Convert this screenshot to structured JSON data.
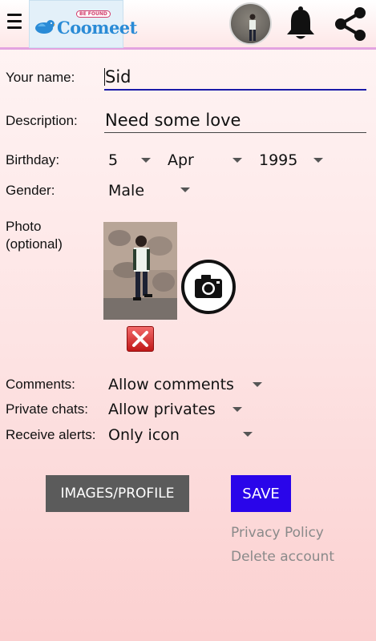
{
  "header": {
    "logo_tag": "BE FOUND",
    "logo_text": "Coomeet",
    "icons": [
      "menu-icon",
      "avatar",
      "bell-icon",
      "share-icon"
    ]
  },
  "form": {
    "name_label": "Your name:",
    "name_value": "Sid",
    "description_label": "Description:",
    "description_value": "Need some love",
    "birthday_label": "Birthday:",
    "birthday_day": "5",
    "birthday_month": "Apr",
    "birthday_year": "1995",
    "gender_label": "Gender:",
    "gender_value": "Male",
    "photo_label": "Photo",
    "photo_optional": "(optional)",
    "comments_label": "Comments:",
    "comments_value": "Allow comments",
    "private_label": "Private chats:",
    "private_value": "Allow privates",
    "alerts_label": "Receive alerts:",
    "alerts_value": "Only icon"
  },
  "actions": {
    "images_button": "IMAGES/PROFILE",
    "save_button": "SAVE",
    "privacy_link": "Privacy Policy",
    "delete_link": "Delete account"
  },
  "colors": {
    "accent_save": "#2a05ea",
    "images_button_bg": "#5b5b5b",
    "focus_underline": "#1a1aa8",
    "delete_red": "#c01818"
  }
}
